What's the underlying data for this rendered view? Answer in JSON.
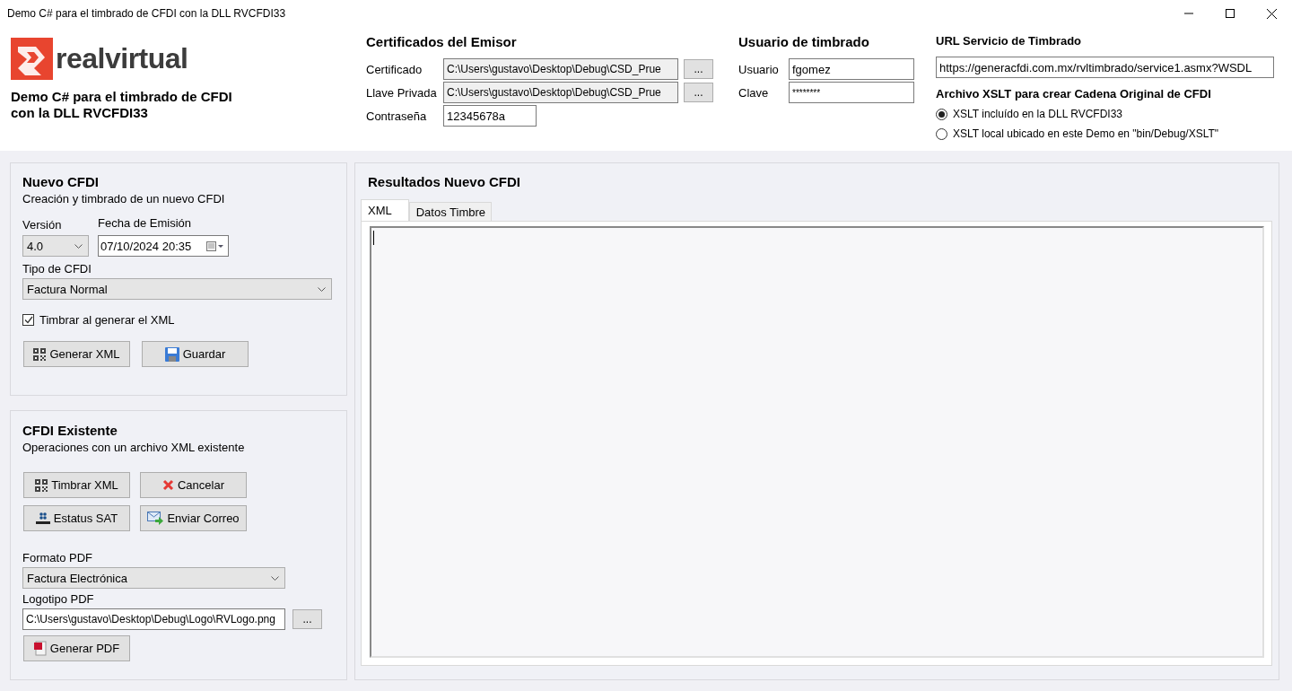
{
  "window": {
    "title": "Demo C# para el timbrado de CFDI con la DLL RVCFDI33"
  },
  "brand": {
    "wordmark": "realvirtual",
    "subtitle_lines": [
      "Demo C# para el timbrado de CFDI",
      "con la DLL RVCFDI33"
    ]
  },
  "certificados": {
    "title": "Certificados del Emisor",
    "fields": [
      {
        "label": "Certificado",
        "value": "C:\\Users\\gustavo\\Desktop\\Debug\\CSD_Prue",
        "readonly": true,
        "browse": "..."
      },
      {
        "label": "Llave Privada",
        "value": "C:\\Users\\gustavo\\Desktop\\Debug\\CSD_Prue",
        "readonly": true,
        "browse": "..."
      },
      {
        "label": "Contraseña",
        "value": "12345678a",
        "readonly": false
      }
    ]
  },
  "usuario": {
    "title": "Usuario de timbrado",
    "fields": [
      {
        "label": "Usuario",
        "value": "fgomez"
      },
      {
        "label": "Clave",
        "value": "********"
      }
    ]
  },
  "servicio": {
    "title": "URL Servicio de Timbrado",
    "value": "https://generacfdi.com.mx/rvltimbrado/service1.asmx?WSDL"
  },
  "xslt": {
    "title": "Archivo XSLT para crear Cadena Original de CFDI",
    "options": [
      {
        "label": "XSLT incluído en la DLL RVCFDI33",
        "selected": true
      },
      {
        "label": "XSLT local ubicado en este Demo en \"bin/Debug/XSLT\"",
        "selected": false
      }
    ]
  },
  "nuevo_cfdi": {
    "title": "Nuevo CFDI",
    "subtitle": "Creación y timbrado de un nuevo CFDI",
    "version": {
      "label": "Versión",
      "value": "4.0"
    },
    "fecha": {
      "label": "Fecha de Emisión",
      "value": "07/10/2024 20:35"
    },
    "tipo": {
      "label": "Tipo de CFDI",
      "value": "Factura Normal"
    },
    "timbrar": {
      "label": "Timbrar al generar el XML",
      "checked": true
    },
    "buttons": [
      {
        "label": "Generar XML"
      },
      {
        "label": "Guardar"
      }
    ]
  },
  "cfdi_existente": {
    "title": "CFDI Existente",
    "subtitle": "Operaciones con un archivo XML existente",
    "buttons": [
      {
        "label": "Timbrar XML"
      },
      {
        "label": "Cancelar"
      },
      {
        "label": "Estatus SAT"
      },
      {
        "label": "Enviar Correo"
      }
    ],
    "formato": {
      "label": "Formato PDF",
      "value": "Factura Electrónica"
    },
    "logotipo": {
      "label": "Logotipo PDF",
      "value": "C:\\Users\\gustavo\\Desktop\\Debug\\Logo\\RVLogo.png",
      "browse": "..."
    },
    "pdf_button": {
      "label": "Generar PDF"
    }
  },
  "resultados": {
    "title": "Resultados Nuevo CFDI",
    "tabs": [
      {
        "label": "XML",
        "selected": true
      },
      {
        "label": "Datos Timbre",
        "selected": false
      }
    ]
  }
}
